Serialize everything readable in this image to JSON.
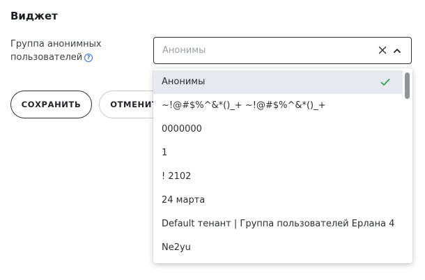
{
  "widget": {
    "title": "Виджет"
  },
  "field": {
    "label": "Группа анонимных пользователей",
    "help_icon": "question-circle-icon"
  },
  "select": {
    "placeholder": "Анонимы",
    "expanded": true
  },
  "buttons": {
    "save_label": "СОХРАНИТЬ",
    "cancel_label": "ОТМЕНИТЬ"
  },
  "dropdown": {
    "options": [
      {
        "label": "Анонимы",
        "selected": true
      },
      {
        "label": "~!@#$%^&*()_+ ~!@#$%^&*()_+",
        "selected": false
      },
      {
        "label": "0000000",
        "selected": false
      },
      {
        "label": "1",
        "selected": false
      },
      {
        "label": "! 2102",
        "selected": false
      },
      {
        "label": "24 марта",
        "selected": false
      },
      {
        "label": "Default тенант | Группа пользователей Ерлана 4",
        "selected": false
      },
      {
        "label": "Ne2yu",
        "selected": false
      }
    ]
  },
  "colors": {
    "check": "#3aa657",
    "help": "#2f6fdb",
    "selected_bg": "#e6eaf0"
  }
}
